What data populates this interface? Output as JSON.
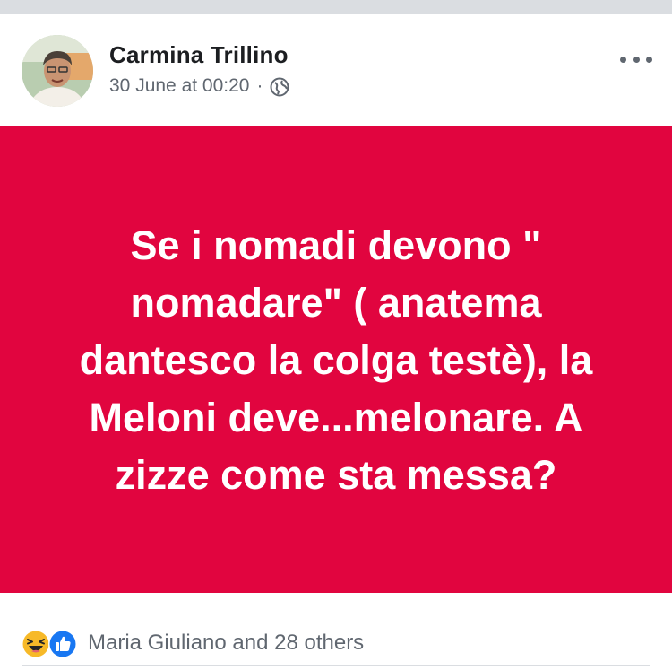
{
  "post": {
    "author": "Carmina Trillino",
    "date": "30 June at 00:20",
    "separator": "·",
    "privacy_icon": "globe-icon",
    "more_icon": "more-options-icon",
    "image_text": "Se i nomadi devono \" nomadare\" ( anatema dantesco la colga testè), la Meloni deve...melonare. A zizze come sta messa?",
    "image_background": "#e1053f",
    "reactions": {
      "icons": [
        "haha-icon",
        "like-icon"
      ],
      "summary": "Maria Giuliano and 28 others"
    }
  },
  "colors": {
    "name": "#1c1e21",
    "meta": "#606770",
    "like_blue": "#1877f2",
    "haha_yellow": "#f7b928"
  }
}
